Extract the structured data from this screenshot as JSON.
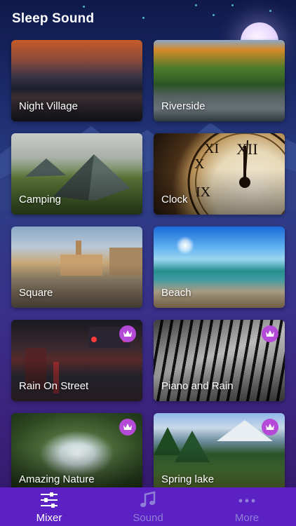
{
  "app": {
    "title": "Sleep Sound"
  },
  "cards": [
    {
      "label": "Night Village",
      "premium": false
    },
    {
      "label": "Riverside",
      "premium": false
    },
    {
      "label": "Camping",
      "premium": false
    },
    {
      "label": "Clock",
      "premium": false
    },
    {
      "label": "Square",
      "premium": false
    },
    {
      "label": "Beach",
      "premium": false
    },
    {
      "label": "Rain On Street",
      "premium": true
    },
    {
      "label": "Piano and Rain",
      "premium": true
    },
    {
      "label": "Amazing Nature",
      "premium": true
    },
    {
      "label": "Spring lake",
      "premium": true
    }
  ],
  "tabs": [
    {
      "label": "Mixer",
      "icon": "sliders-icon",
      "active": true
    },
    {
      "label": "Sound",
      "icon": "music-note-icon",
      "active": false
    },
    {
      "label": "More",
      "icon": "more-dots-icon",
      "active": false
    }
  ],
  "colors": {
    "tab_bar": "#5b21c4",
    "crown_badge": "#b54ad8",
    "tab_inactive": "#8f7fd6"
  }
}
